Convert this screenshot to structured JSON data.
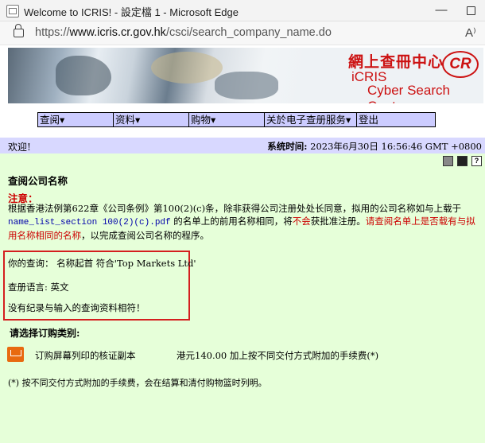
{
  "window": {
    "title": "Welcome to ICRIS! - 設定檔 1 - Microsoft Edge",
    "minimize_glyph": "—"
  },
  "address_bar": {
    "url_prefix": "https://",
    "url_host": "www.icris.cr.gov.hk",
    "url_path": "/csci/search_company_name.do",
    "read_aloud_glyph": "A⁾"
  },
  "banner": {
    "title_cn": "網上查冊中心",
    "brand_line1": "iCRIS",
    "brand_line2": "Cyber Search Centre",
    "logo_text": "CR"
  },
  "menu": {
    "items": [
      "查阅▾",
      "资料▾",
      "购物▾",
      "关於电子查册服务▾",
      "登出"
    ]
  },
  "welcome_bar": {
    "welcome": "欢迎!",
    "time_label": "系统时间:",
    "time_value": "2023年6月30日 16:56:46 GMT +0800"
  },
  "content": {
    "page_title": "查阅公司名称",
    "notice_label": "注意：",
    "notice_part1": "根据香港法例第622章《公司条例》第100(2)(c)条，除非获得公司注册处处长同意，拟用的公司名称如与上载于",
    "notice_link": "name_list_section 100(2)(c).pdf",
    "notice_part2": " 的名单上的前用名称相同，将",
    "notice_not": "不会",
    "notice_part3": "获批准注册。",
    "notice_red": "请查阅名单上是否载有与拟用名称相同的名称",
    "notice_part4": "，以完成查阅公司名称的程序。",
    "query_line": "你的查询： 名称起首 符合'Top Markets Ltd'",
    "language_line": "查册语言: 英文",
    "no_record_line": "没有纪录与输入的查询资料相符！",
    "order_title": "请选择订购类别:",
    "order_item": "订购屏幕列印的核证副本",
    "order_price": "港元140.00 加上按不同交付方式附加的手续费(*)",
    "footnote": "(*) 按不同交付方式附加的手续费，会在结算和清付购物篮时列明。"
  },
  "colors": {
    "menu_bg": "#ccccff",
    "welcome_bg": "#d8d8ff",
    "content_bg": "#e6ffd9",
    "notice_red": "#cc0000",
    "highlight_box": "#d41f1f",
    "cart_orange": "#e86a10"
  },
  "icons": [
    "window-icon",
    "lock-icon",
    "read-aloud-icon",
    "print-icon",
    "save-icon",
    "help-icon",
    "cart-icon"
  ]
}
